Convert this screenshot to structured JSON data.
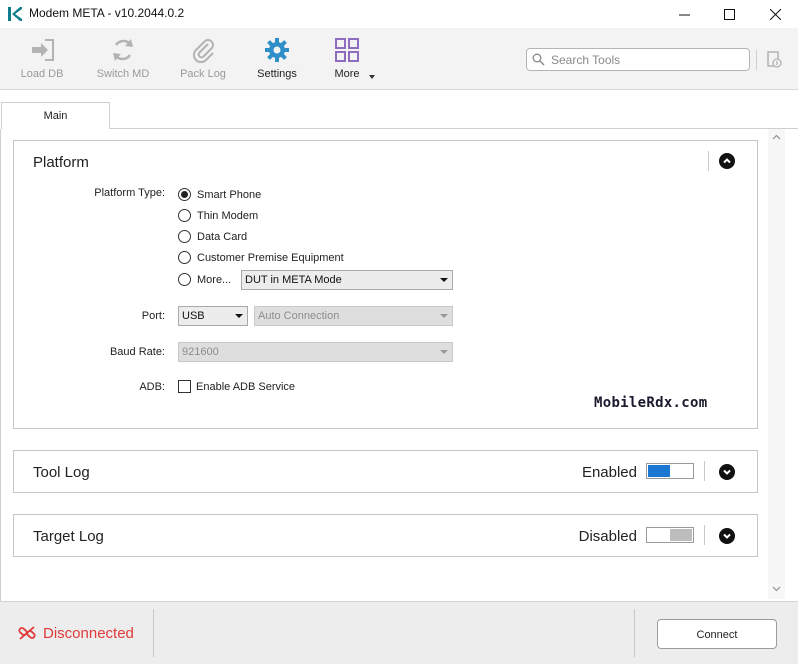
{
  "window": {
    "title": "Modem META - v10.2044.0.2",
    "controls": [
      "minimize",
      "maximize",
      "close"
    ]
  },
  "toolbar": {
    "items": [
      {
        "label": "Load DB",
        "icon": "load-db-icon",
        "enabled": false
      },
      {
        "label": "Switch MD",
        "icon": "switch-md-icon",
        "enabled": false
      },
      {
        "label": "Pack Log",
        "icon": "paperclip-icon",
        "enabled": false
      },
      {
        "label": "Settings",
        "icon": "gear-icon",
        "enabled": true
      },
      {
        "label": "More",
        "icon": "grid-icon",
        "enabled": true
      }
    ],
    "search_placeholder": "Search Tools",
    "accent_color": "#2e8fc9",
    "more_color": "#8e6cc0"
  },
  "tabs": [
    {
      "label": "Main",
      "active": true
    }
  ],
  "platform": {
    "title": "Platform",
    "platform_type_label": "Platform Type:",
    "options": [
      {
        "label": "Smart Phone",
        "checked": true
      },
      {
        "label": "Thin Modem",
        "checked": false
      },
      {
        "label": "Data Card",
        "checked": false
      },
      {
        "label": "Customer Premise Equipment",
        "checked": false
      },
      {
        "label": "More...",
        "checked": false
      }
    ],
    "more_select_value": "DUT in META Mode",
    "port_label": "Port:",
    "port_value": "USB",
    "port_mode_value": "Auto Connection",
    "baud_label": "Baud Rate:",
    "baud_value": "921600",
    "adb_label": "ADB:",
    "adb_checkbox_label": "Enable ADB Service",
    "adb_checked": false,
    "watermark": "MobileRdx.com"
  },
  "tool_log": {
    "title": "Tool Log",
    "status": "Enabled",
    "enabled": true,
    "toggle_color": "#1a78d2"
  },
  "target_log": {
    "title": "Target Log",
    "status": "Disabled",
    "enabled": false
  },
  "footer": {
    "status": "Disconnected",
    "status_color": "#e03a3a",
    "connect_label": "Connect"
  }
}
